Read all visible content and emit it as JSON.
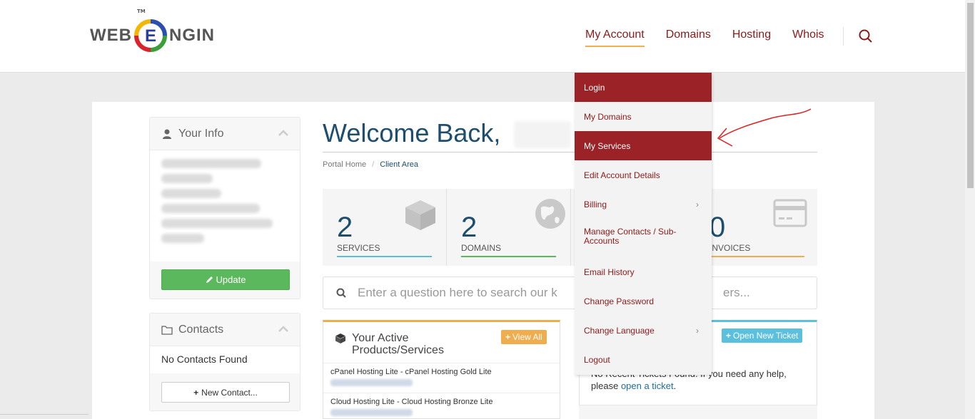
{
  "logo": {
    "part1": "WEB",
    "part2": "NGIN",
    "tm": "TM"
  },
  "nav": {
    "items": [
      "My Account",
      "Domains",
      "Hosting",
      "Whois"
    ]
  },
  "sidebar": {
    "your_info": {
      "title": "Your Info",
      "update_label": "Update"
    },
    "contacts": {
      "title": "Contacts",
      "empty": "No Contacts Found",
      "new_label": "New Contact..."
    }
  },
  "welcome": {
    "title": "Welcome Back,"
  },
  "breadcrumb": {
    "home": "Portal Home",
    "current": "Client Area"
  },
  "stats": [
    {
      "value": "2",
      "label": "SERVICES",
      "color": "#5bc0de"
    },
    {
      "value": "2",
      "label": "DOMAINS",
      "color": "#5cb85c"
    },
    {
      "value": "0",
      "label": "INVOICES",
      "color": "#f0ad4e"
    }
  ],
  "kb_search": {
    "placeholder": "Enter a question here to search our k",
    "placeholder_end": "ers..."
  },
  "active_services": {
    "title_line1": "Your Active",
    "title_line2": "Products/Services",
    "view_all": "View All",
    "rows": [
      {
        "name": "cPanel Hosting Lite - cPanel Hosting Gold Lite"
      },
      {
        "name": "Cloud Hosting Lite - Cloud Hosting Bronze Lite"
      }
    ]
  },
  "tickets": {
    "open_new": "Open New Ticket",
    "text_pre": "No Recent Tickets Found. If you need any help, please",
    "link": "open a ticket",
    "text_post": "."
  },
  "dropdown": {
    "items": [
      {
        "label": "Login"
      },
      {
        "label": "My Domains"
      },
      {
        "label": "My Services"
      },
      {
        "label": "Edit Account Details"
      },
      {
        "label": "Billing",
        "arrow": "›"
      },
      {
        "label": "Manage Contacts / Sub-Accounts"
      },
      {
        "label": "Email History"
      },
      {
        "label": "Change Password"
      },
      {
        "label": "Change Language",
        "arrow": "›"
      },
      {
        "label": "Logout"
      }
    ]
  },
  "colors": {
    "brand": "#9b2226",
    "accent_blue": "#1e4e6e",
    "green": "#5cb85c",
    "orange": "#f0ad4e",
    "info": "#5bc0de"
  }
}
